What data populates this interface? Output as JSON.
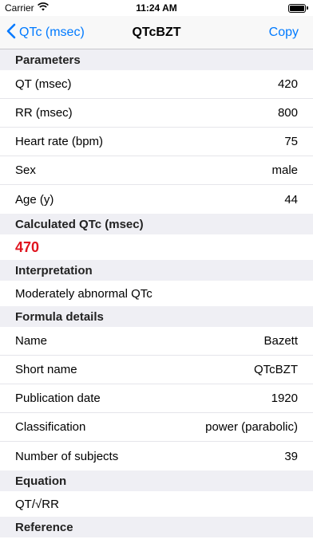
{
  "status": {
    "carrier": "Carrier",
    "time": "11:24 AM"
  },
  "nav": {
    "back_label": "QTc (msec)",
    "title": "QTcBZT",
    "copy_label": "Copy"
  },
  "sections": {
    "parameters": "Parameters",
    "calculated": "Calculated QTc (msec)",
    "interpretation": "Interpretation",
    "formula": "Formula details",
    "equation": "Equation",
    "reference": "Reference"
  },
  "parameters": [
    {
      "label": "QT (msec)",
      "value": "420"
    },
    {
      "label": "RR (msec)",
      "value": "800"
    },
    {
      "label": "Heart rate (bpm)",
      "value": "75"
    },
    {
      "label": "Sex",
      "value": "male"
    },
    {
      "label": "Age (y)",
      "value": "44"
    }
  ],
  "calculated_qtc": "470",
  "interpretation": "Moderately abnormal QTc",
  "formula_details": [
    {
      "label": "Name",
      "value": "Bazett"
    },
    {
      "label": "Short name",
      "value": "QTcBZT"
    },
    {
      "label": "Publication date",
      "value": "1920"
    },
    {
      "label": "Classification",
      "value": "power (parabolic)"
    },
    {
      "label": "Number of subjects",
      "value": "39"
    }
  ],
  "equation": "QT/√RR",
  "colors": {
    "accent": "#007aff",
    "result": "#e0141e",
    "section_bg": "#efeff4"
  }
}
